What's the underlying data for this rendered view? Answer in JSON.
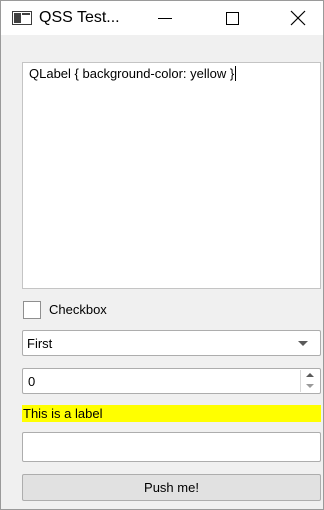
{
  "window": {
    "title": "QSS Test..."
  },
  "editor": {
    "text": "QLabel { background-color: yellow }"
  },
  "checkbox": {
    "label": "Checkbox",
    "checked": false
  },
  "combo": {
    "selected": "First"
  },
  "spinbox": {
    "value": "0"
  },
  "label": {
    "text": "This is a label",
    "background": "#ffff00"
  },
  "line_edit": {
    "value": ""
  },
  "button": {
    "label": "Push me!"
  },
  "icons": {
    "app": "window-app-icon",
    "minimize": "minimize-icon",
    "maximize": "maximize-icon",
    "close": "close-icon",
    "combo_arrow": "chevron-down-icon",
    "spin_up": "spin-up-icon",
    "spin_down": "spin-down-icon"
  }
}
